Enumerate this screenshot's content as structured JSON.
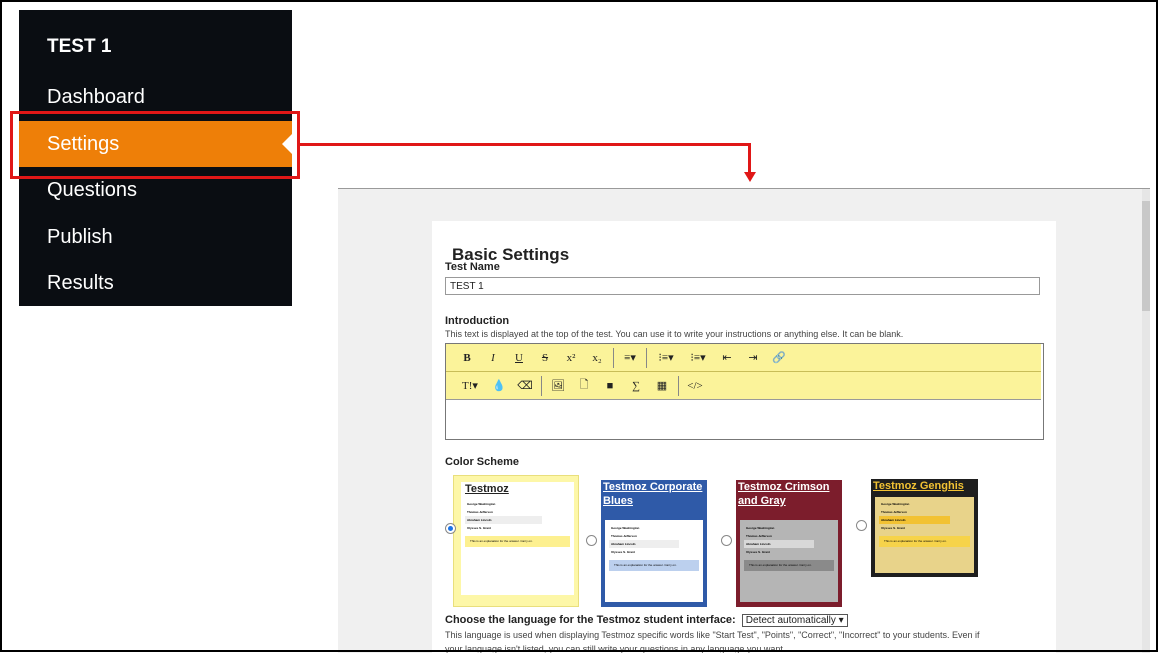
{
  "sidebar": {
    "title": "TEST 1",
    "items": [
      {
        "label": "Dashboard"
      },
      {
        "label": "Settings",
        "active": true
      },
      {
        "label": "Questions"
      },
      {
        "label": "Publish"
      },
      {
        "label": "Results"
      }
    ]
  },
  "settings": {
    "heading": "Basic Settings",
    "test_name_label": "Test Name",
    "test_name_value": "TEST 1",
    "intro_label": "Introduction",
    "intro_hint": "This text is displayed at the top of the test. You can use it to write your instructions or anything else. It can be blank.",
    "toolbar_row1": [
      "B",
      "I",
      "U",
      "S",
      "x²",
      "x₂",
      "≡▾",
      "⁝≡▾",
      "⁝≡▾",
      "⇤",
      "⇥",
      "🔗"
    ],
    "toolbar_row2": [
      "T!▾",
      "💧",
      "⌫",
      "🖼",
      "🗋",
      "■",
      "∑",
      "▦",
      "</>"
    ],
    "color_scheme_label": "Color Scheme",
    "schemes": [
      {
        "title": "Testmoz",
        "selected": true
      },
      {
        "title": "Testmoz Corporate Blues",
        "selected": false
      },
      {
        "title": "Testmoz Crimson and Gray",
        "selected": false
      },
      {
        "title": "Testmoz Genghis",
        "selected": false
      }
    ],
    "preview_names": [
      "George Washington",
      "Thomas Jefferson",
      "Abraham Lincoln",
      "Ulysses S. Grant"
    ],
    "preview_explanation": "This is an explanation for the answer. Carry on.",
    "language_label": "Choose the language for the Testmoz student interface:",
    "language_value": "Detect automatically",
    "language_hint": "This language is used when displaying Testmoz specific words like \"Start Test\", \"Points\", \"Correct\", \"Incorrect\" to your students. Even if",
    "language_hint2": "your language isn't listed, you can still write your questions in any language you want."
  },
  "colors": {
    "sidebar_bg": "#0a0d12",
    "active_item": "#ee7f08",
    "highlight": "#e01717",
    "editor_toolbar": "#fbf39a",
    "scheme_testmoz": "#fdf7a8",
    "scheme_blues": "#2f5aa8",
    "scheme_crimson": "#7c1d2c",
    "scheme_genghis": "#1e1e1e"
  }
}
